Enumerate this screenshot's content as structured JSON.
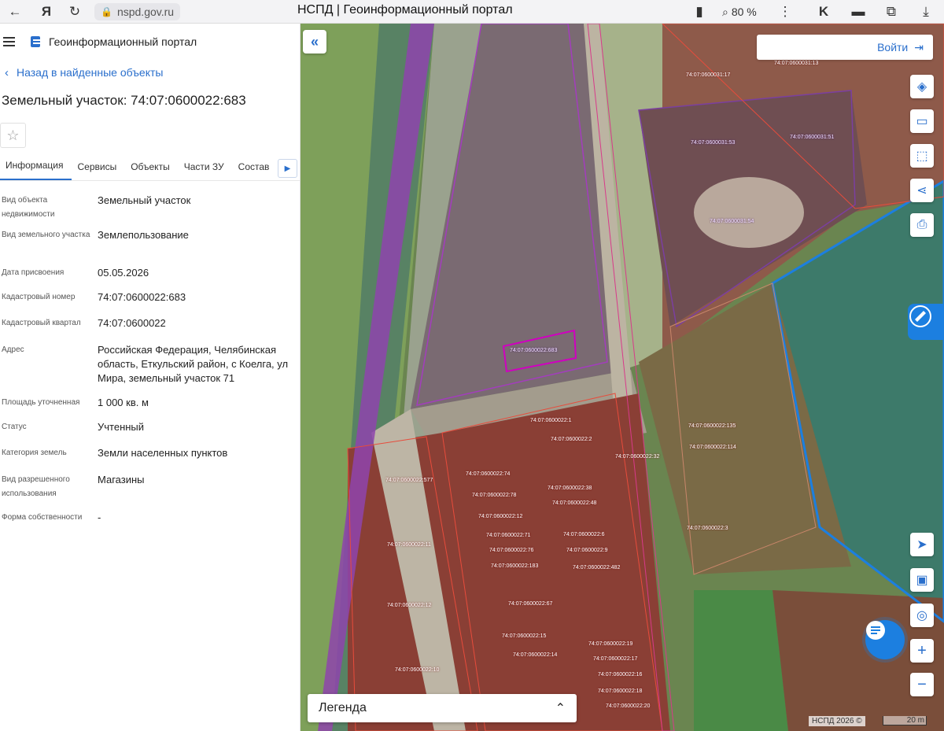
{
  "browser": {
    "url": "nspd.gov.ru",
    "title": "НСПД | Геоинформационный портал",
    "zoom": "80 %"
  },
  "sidebar": {
    "portal_title": "Геоинформационный портал",
    "back_label": "Назад в найденные объекты",
    "parcel_title": "Земельный участок: 74:07:0600022:683",
    "tabs": [
      "Информация",
      "Сервисы",
      "Объекты",
      "Части ЗУ",
      "Состав"
    ],
    "active_tab": "Информация",
    "properties": [
      {
        "label": "Вид объекта недвижимости",
        "value": "Земельный участок"
      },
      {
        "label": "Вид земельного участка",
        "value": "Землепользование"
      },
      {
        "label": "Дата присвоения",
        "value": "05.05.2026"
      },
      {
        "label": "Кадастровый номер",
        "value": "74:07:0600022:683"
      },
      {
        "label": "Кадастровый квартал",
        "value": "74:07:0600022"
      },
      {
        "label": "Адрес",
        "value": "Российская Федерация, Челябинская область, Еткульский район, с Коелга, ул Мира, земельный участок 71"
      },
      {
        "label": "Площадь уточненная",
        "value": "1 000 кв. м"
      },
      {
        "label": "Статус",
        "value": "Учтенный"
      },
      {
        "label": "Категория земель",
        "value": "Земли населенных пунктов"
      },
      {
        "label": "Вид разрешенного использования",
        "value": "Магазины"
      },
      {
        "label": "Форма собственности",
        "value": "-"
      }
    ]
  },
  "map": {
    "login_label": "Войти",
    "legend_label": "Легенда",
    "attribution": "НСПД 2026 ©",
    "scale_label": "20 m",
    "cadastral_labels": [
      "74:07:0600022:683",
      "74:07:0600031:53",
      "74:07:0600031:51",
      "74:07:0600031:54",
      "74:07:0600031:17",
      "74:07:0600031:13",
      "74:07:0600022:577",
      "74:07:0600022:1",
      "74:07:0600022:2",
      "74:07:0600022:32",
      "74:07:0600022:74",
      "74:07:0600022:78",
      "74:07:0600022:38",
      "74:07:0600022:48",
      "74:07:0600022:12",
      "74:07:0600022:71",
      "74:07:0600022:6",
      "74:07:0600022:76",
      "74:07:0600022:9",
      "74:07:0600022:183",
      "74:07:0600022:482",
      "74:07:0600022:11",
      "74:07:0600022:12",
      "74:07:0600022:67",
      "74:07:0600022:15",
      "74:07:0600022:14",
      "74:07:0600022:19",
      "74:07:0600022:17",
      "74:07:0600022:16",
      "74:07:0600022:18",
      "74:07:0600022:10",
      "74:07:0600022:135",
      "74:07:0600022:114",
      "74:07:0600022:3",
      "74:07:0600022:20"
    ]
  },
  "colors": {
    "accent": "#2a6fcc",
    "parcel_red": "#c0392b",
    "parcel_purple": "#8e44ad",
    "zone_blue": "#1c7fe0",
    "zone_green": "#2ecc71"
  }
}
